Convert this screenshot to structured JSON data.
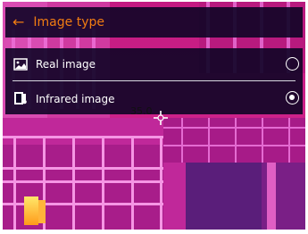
{
  "header": {
    "back_icon": "arrow-left-icon",
    "title": "Image type"
  },
  "options": [
    {
      "icon": "image-icon",
      "label": "Real image",
      "selected": false
    },
    {
      "icon": "thermometer-image-icon",
      "label": "Infrared image",
      "selected": true
    }
  ],
  "measurement": {
    "temperature": "35.0"
  },
  "colors": {
    "accent": "#f07c12",
    "panel": "#0e0426",
    "text": "#ffffff"
  }
}
